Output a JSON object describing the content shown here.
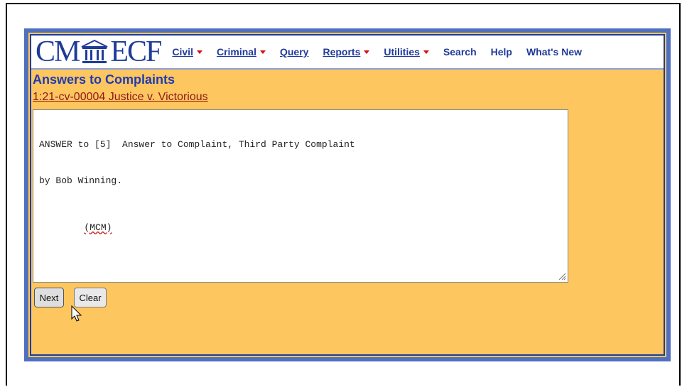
{
  "app": {
    "logo_left": "CM",
    "logo_right": "ECF"
  },
  "menu": {
    "items": [
      {
        "label": "Civil",
        "has_caret": true
      },
      {
        "label": "Criminal",
        "has_caret": true
      },
      {
        "label": "Query",
        "has_caret": false
      },
      {
        "label": "Reports",
        "has_caret": true
      },
      {
        "label": "Utilities",
        "has_caret": true
      },
      {
        "label": "Search",
        "has_caret": false
      },
      {
        "label": "Help",
        "has_caret": false
      },
      {
        "label": "What's New",
        "has_caret": false
      }
    ]
  },
  "page": {
    "title": "Answers to Complaints",
    "case_link": "1:21-cv-00004 Justice v. Victorious"
  },
  "docket_text": {
    "line1": "ANSWER to [5]  Answer to Complaint, Third Party Complaint",
    "line2": "by Bob Winning.",
    "initials": "(MCM)"
  },
  "buttons": {
    "next_label": "Next",
    "clear_label": "Clear"
  },
  "colors": {
    "page_background": "#fec65e",
    "brand_blue": "#1f3b99",
    "frame_blue": "#4f6fbf",
    "caret_red": "#d01010",
    "link_maroon": "#8b1a1a"
  }
}
